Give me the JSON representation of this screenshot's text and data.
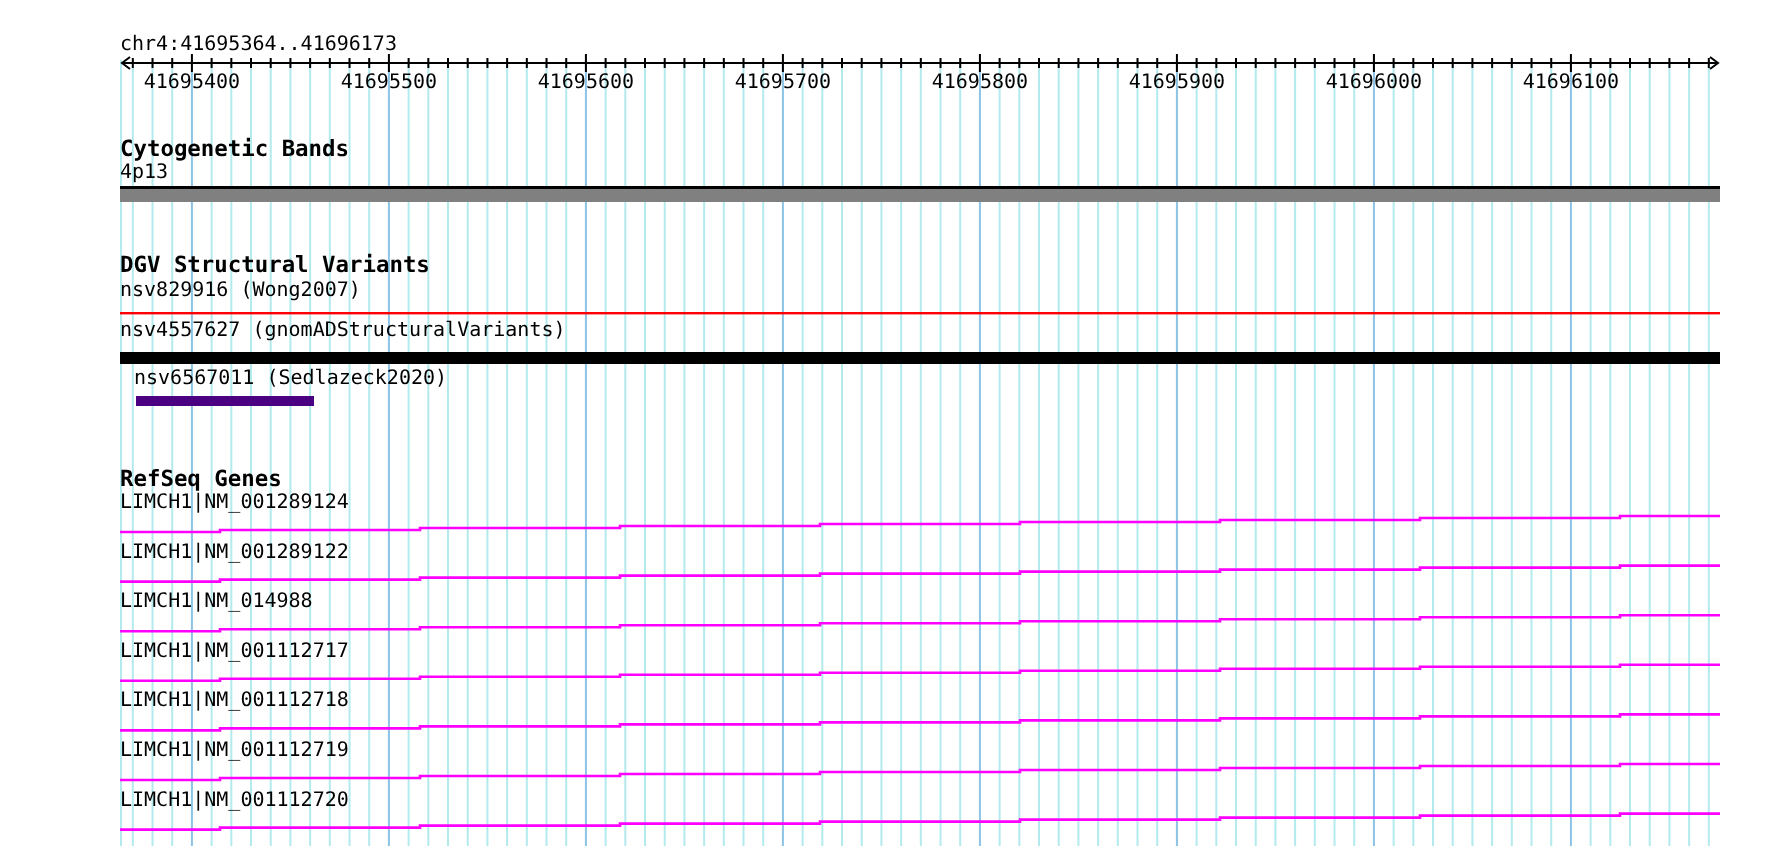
{
  "region": {
    "label": "chr4:41695364..41696173"
  },
  "ruler": {
    "ticks": [
      "41695400",
      "41695500",
      "41695600",
      "41695700",
      "41695800",
      "41695900",
      "41696000",
      "41696100"
    ]
  },
  "tracks": [
    {
      "title": "Cytogenetic Bands",
      "kind": "band",
      "features": [
        {
          "label": "4p13"
        }
      ]
    },
    {
      "title": "DGV Structural Variants",
      "kind": "variant",
      "features": [
        {
          "label": "nsv829916 (Wong2007)",
          "color": "#ff0000"
        },
        {
          "label": "nsv4557627 (gnomADStructuralVariants)",
          "color": "#000000"
        },
        {
          "label": "nsv6567011 (Sedlazeck2020)",
          "color": "#4b0082"
        }
      ]
    },
    {
      "title": "RefSeq Genes",
      "kind": "gene",
      "features": [
        {
          "label": "LIMCH1|NM_001289124"
        },
        {
          "label": "LIMCH1|NM_001289122"
        },
        {
          "label": "LIMCH1|NM_014988"
        },
        {
          "label": "LIMCH1|NM_001112717"
        },
        {
          "label": "LIMCH1|NM_001112718"
        },
        {
          "label": "LIMCH1|NM_001112719"
        },
        {
          "label": "LIMCH1|NM_001112720"
        }
      ]
    }
  ]
}
